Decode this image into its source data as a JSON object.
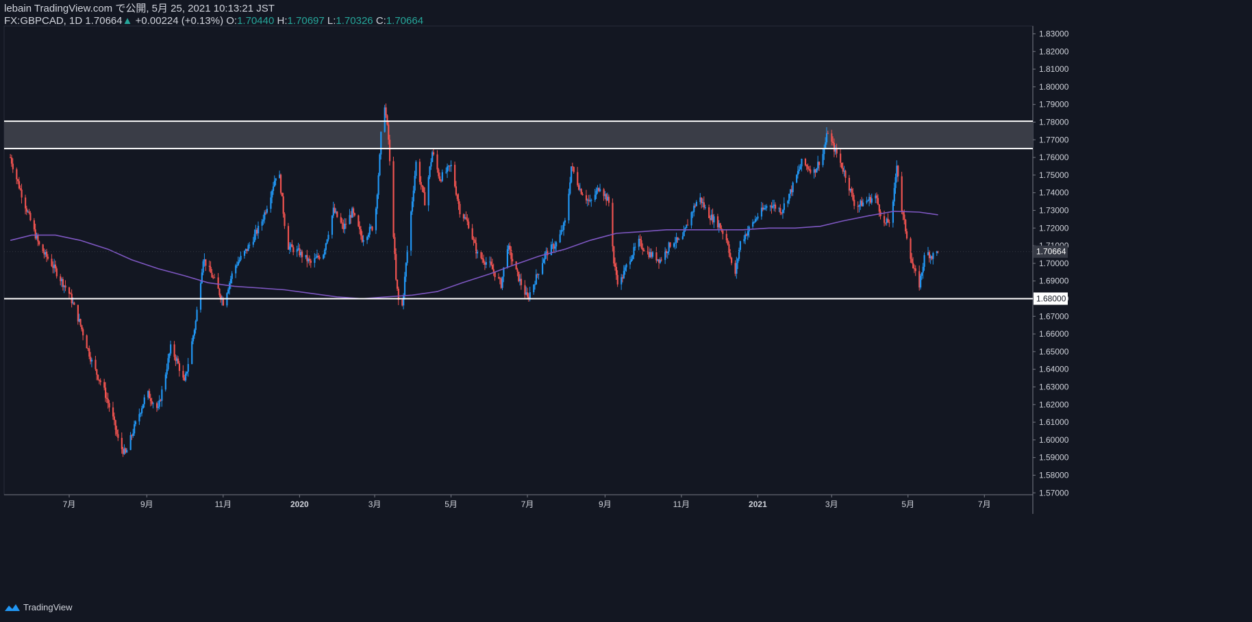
{
  "header": {
    "line1": "lebain TradingView.com で公開, 5月 25, 2021 10:13:21 JST",
    "symbol": "FX:GBPCAD, 1D",
    "last": "1.70664",
    "change": "+0.00224 (+0.13%)",
    "o_label": "O:",
    "o": "1.70440",
    "h_label": "H:",
    "h": "1.70697",
    "l_label": "L:",
    "l": "1.70326",
    "c_label": "C:",
    "c": "1.70664"
  },
  "footer": {
    "brand": "TradingView"
  },
  "colors": {
    "background": "#131722",
    "up": "#2196f3",
    "down": "#ef5350",
    "ma": "#7e57c2",
    "zone_fill": "#3a3d47",
    "level_line": "#ffffff",
    "axis_text": "#d1d4dc",
    "change_up": "#26a69a"
  },
  "chart_data": {
    "type": "candlestick",
    "symbol": "FX:GBPCAD",
    "interval": "1D",
    "ylim": [
      1.565,
      1.832
    ],
    "y_ticks": [
      "1.83000",
      "1.82000",
      "1.81000",
      "1.80000",
      "1.79000",
      "1.78000",
      "1.77000",
      "1.76000",
      "1.75000",
      "1.74000",
      "1.73000",
      "1.72000",
      "1.71000",
      "1.70000",
      "1.69000",
      "1.68000",
      "1.67000",
      "1.66000",
      "1.65000",
      "1.64000",
      "1.63000",
      "1.62000",
      "1.61000",
      "1.60000",
      "1.59000",
      "1.58000",
      "1.57000"
    ],
    "x_ticks": [
      {
        "label": "7月",
        "date": "2019-07-01"
      },
      {
        "label": "9月",
        "date": "2019-09-01"
      },
      {
        "label": "11月",
        "date": "2019-11-01"
      },
      {
        "label": "2020",
        "date": "2020-01-01"
      },
      {
        "label": "3月",
        "date": "2020-03-01"
      },
      {
        "label": "5月",
        "date": "2020-05-01"
      },
      {
        "label": "7月",
        "date": "2020-07-01"
      },
      {
        "label": "9月",
        "date": "2020-09-01"
      },
      {
        "label": "11月",
        "date": "2020-11-01"
      },
      {
        "label": "2021",
        "date": "2021-01-01"
      },
      {
        "label": "3月",
        "date": "2021-03-01"
      },
      {
        "label": "5月",
        "date": "2021-05-01"
      },
      {
        "label": "7月",
        "date": "2021-07-01"
      }
    ],
    "price_label": "1.70664",
    "level_label": "1.68000",
    "resistance_zone": [
      1.765,
      1.7805
    ],
    "support_level": 1.68,
    "close_path": [
      [
        "2019-05-15",
        1.76
      ],
      [
        "2019-05-20",
        1.748
      ],
      [
        "2019-06-01",
        1.722
      ],
      [
        "2019-06-08",
        1.708
      ],
      [
        "2019-06-15",
        1.702
      ],
      [
        "2019-06-25",
        1.69
      ],
      [
        "2019-07-01",
        1.683
      ],
      [
        "2019-07-10",
        1.665
      ],
      [
        "2019-07-20",
        1.642
      ],
      [
        "2019-07-28",
        1.63
      ],
      [
        "2019-08-05",
        1.612
      ],
      [
        "2019-08-10",
        1.597
      ],
      [
        "2019-08-15",
        1.592
      ],
      [
        "2019-08-22",
        1.607
      ],
      [
        "2019-09-01",
        1.627
      ],
      [
        "2019-09-10",
        1.617
      ],
      [
        "2019-09-20",
        1.652
      ],
      [
        "2019-09-25",
        1.645
      ],
      [
        "2019-10-01",
        1.632
      ],
      [
        "2019-10-10",
        1.667
      ],
      [
        "2019-10-16",
        1.703
      ],
      [
        "2019-10-25",
        1.69
      ],
      [
        "2019-11-01",
        1.678
      ],
      [
        "2019-11-10",
        1.698
      ],
      [
        "2019-11-20",
        1.708
      ],
      [
        "2019-12-01",
        1.722
      ],
      [
        "2019-12-08",
        1.737
      ],
      [
        "2019-12-15",
        1.755
      ],
      [
        "2019-12-22",
        1.71
      ],
      [
        "2020-01-01",
        1.706
      ],
      [
        "2020-01-10",
        1.7
      ],
      [
        "2020-01-20",
        1.706
      ],
      [
        "2020-01-28",
        1.73
      ],
      [
        "2020-02-05",
        1.72
      ],
      [
        "2020-02-12",
        1.729
      ],
      [
        "2020-02-20",
        1.714
      ],
      [
        "2020-03-01",
        1.722
      ],
      [
        "2020-03-05",
        1.76
      ],
      [
        "2020-03-08",
        1.797
      ],
      [
        "2020-03-12",
        1.77
      ],
      [
        "2020-03-18",
        1.69
      ],
      [
        "2020-03-22",
        1.668
      ],
      [
        "2020-03-28",
        1.715
      ],
      [
        "2020-04-03",
        1.757
      ],
      [
        "2020-04-10",
        1.735
      ],
      [
        "2020-04-16",
        1.763
      ],
      [
        "2020-04-22",
        1.748
      ],
      [
        "2020-05-01",
        1.755
      ],
      [
        "2020-05-08",
        1.73
      ],
      [
        "2020-05-15",
        1.722
      ],
      [
        "2020-05-22",
        1.705
      ],
      [
        "2020-06-01",
        1.699
      ],
      [
        "2020-06-10",
        1.688
      ],
      [
        "2020-06-15",
        1.71
      ],
      [
        "2020-06-22",
        1.695
      ],
      [
        "2020-07-01",
        1.68
      ],
      [
        "2020-07-08",
        1.692
      ],
      [
        "2020-07-15",
        1.705
      ],
      [
        "2020-07-25",
        1.712
      ],
      [
        "2020-08-01",
        1.725
      ],
      [
        "2020-08-05",
        1.755
      ],
      [
        "2020-08-12",
        1.742
      ],
      [
        "2020-08-20",
        1.734
      ],
      [
        "2020-08-28",
        1.744
      ],
      [
        "2020-09-05",
        1.733
      ],
      [
        "2020-09-08",
        1.7
      ],
      [
        "2020-09-12",
        1.687
      ],
      [
        "2020-09-20",
        1.702
      ],
      [
        "2020-09-28",
        1.712
      ],
      [
        "2020-10-05",
        1.706
      ],
      [
        "2020-10-15",
        1.702
      ],
      [
        "2020-10-25",
        1.713
      ],
      [
        "2020-11-01",
        1.712
      ],
      [
        "2020-11-08",
        1.727
      ],
      [
        "2020-11-15",
        1.738
      ],
      [
        "2020-11-22",
        1.728
      ],
      [
        "2020-12-01",
        1.722
      ],
      [
        "2020-12-08",
        1.712
      ],
      [
        "2020-12-13",
        1.69
      ],
      [
        "2020-12-18",
        1.712
      ],
      [
        "2021-01-01",
        1.727
      ],
      [
        "2021-01-10",
        1.734
      ],
      [
        "2021-01-20",
        1.73
      ],
      [
        "2021-01-28",
        1.742
      ],
      [
        "2021-02-05",
        1.757
      ],
      [
        "2021-02-15",
        1.752
      ],
      [
        "2021-02-22",
        1.762
      ],
      [
        "2021-02-26",
        1.775
      ],
      [
        "2021-03-01",
        1.768
      ],
      [
        "2021-03-05",
        1.762
      ],
      [
        "2021-03-12",
        1.75
      ],
      [
        "2021-03-20",
        1.732
      ],
      [
        "2021-03-28",
        1.735
      ],
      [
        "2021-04-05",
        1.738
      ],
      [
        "2021-04-12",
        1.722
      ],
      [
        "2021-04-18",
        1.725
      ],
      [
        "2021-04-22",
        1.757
      ],
      [
        "2021-04-26",
        1.73
      ],
      [
        "2021-05-01",
        1.712
      ],
      [
        "2021-05-05",
        1.697
      ],
      [
        "2021-05-10",
        1.688
      ],
      [
        "2021-05-15",
        1.707
      ],
      [
        "2021-05-20",
        1.704
      ],
      [
        "2021-05-25",
        1.70664
      ]
    ],
    "moving_average": [
      [
        "2019-05-15",
        1.713
      ],
      [
        "2019-06-01",
        1.716
      ],
      [
        "2019-06-20",
        1.716
      ],
      [
        "2019-07-10",
        1.713
      ],
      [
        "2019-08-01",
        1.708
      ],
      [
        "2019-08-20",
        1.702
      ],
      [
        "2019-09-10",
        1.697
      ],
      [
        "2019-10-01",
        1.693
      ],
      [
        "2019-10-20",
        1.689
      ],
      [
        "2019-11-10",
        1.687
      ],
      [
        "2019-12-01",
        1.686
      ],
      [
        "2019-12-20",
        1.685
      ],
      [
        "2020-01-10",
        1.683
      ],
      [
        "2020-01-31",
        1.681
      ],
      [
        "2020-02-20",
        1.68
      ],
      [
        "2020-03-10",
        1.681
      ],
      [
        "2020-03-31",
        1.682
      ],
      [
        "2020-04-20",
        1.684
      ],
      [
        "2020-05-10",
        1.689
      ],
      [
        "2020-06-01",
        1.694
      ],
      [
        "2020-06-20",
        1.699
      ],
      [
        "2020-07-10",
        1.704
      ],
      [
        "2020-07-31",
        1.708
      ],
      [
        "2020-08-20",
        1.713
      ],
      [
        "2020-09-10",
        1.717
      ],
      [
        "2020-10-01",
        1.718
      ],
      [
        "2020-10-20",
        1.719
      ],
      [
        "2020-11-10",
        1.719
      ],
      [
        "2020-12-01",
        1.719
      ],
      [
        "2020-12-20",
        1.719
      ],
      [
        "2021-01-10",
        1.72
      ],
      [
        "2021-01-31",
        1.72
      ],
      [
        "2021-02-20",
        1.721
      ],
      [
        "2021-03-10",
        1.724
      ],
      [
        "2021-03-31",
        1.727
      ],
      [
        "2021-04-20",
        1.7295
      ],
      [
        "2021-05-10",
        1.729
      ],
      [
        "2021-05-25",
        1.7275
      ]
    ]
  }
}
